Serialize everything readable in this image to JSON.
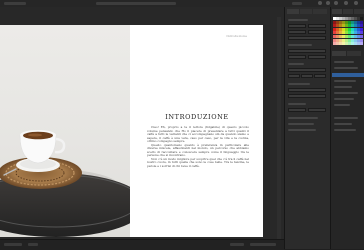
{
  "document": {
    "header_label": "Introduzione",
    "title": "INTRODUZIONE",
    "paragraphs": [
      "Ciao! Eh, proprio a te il lettore (fidgabile) di questo piccolo volume pensando che Ho il piacere di presentare a tutti quanti il caffè a tutti le varianti che ci accompagnano sin da quando siamo e sapere, il caffè è una vera, caso per caso, per la vita e la cucina, ottimo compagno sempre.",
      "Questo quantomeno quanto è preferenza in particolare alle diverse miscele, affascinanti nel mondo, un percorso che abbiamo scelto di raccontare e conoscere sempre come il linguaggio tra le persone che si incontrano.",
      "Non c'è un modo migliore per scoprire quel che c'è tra il caffè nel nostro cuore, in tutti quelle che sono le cose belle. Tra le tazzine, le parole e i sorrisi di chi beve il caffè."
    ]
  },
  "colors": {
    "accent": "#2f5f9c",
    "canvas": "#282828",
    "panel": "#2b2b2b"
  }
}
